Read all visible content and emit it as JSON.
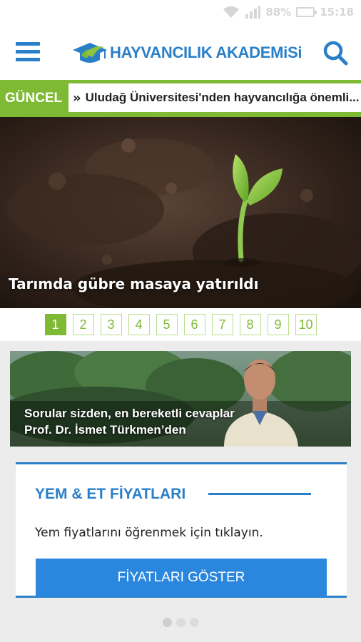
{
  "status_bar": {
    "battery": "88%",
    "time": "15:18",
    "icons": [
      "wifi-icon",
      "signal-icon",
      "battery-icon"
    ]
  },
  "header": {
    "brand": "HAYVANCILIK AKADEMiSi",
    "menu_icon": "hamburger-menu-icon",
    "search_icon": "search-icon"
  },
  "ticker": {
    "label": "GÜNCEL",
    "arrow": "»",
    "headline": "Uludağ Üniversitesi'nden hayvancılığa önemli..."
  },
  "hero": {
    "caption": "Tarımda gübre masaya yatırıldı"
  },
  "pagination": {
    "pages": [
      "1",
      "2",
      "3",
      "4",
      "5",
      "6",
      "7",
      "8",
      "9",
      "10"
    ],
    "active_index": 0
  },
  "promo": {
    "line1": "Sorular sizden, en bereketli cevaplar",
    "line2": "Prof. Dr. İsmet Türkmen’den"
  },
  "price_card": {
    "title": "YEM & ET FİYATLARI",
    "text": "Yem fiyatlarını öğrenmek için tıklayın.",
    "button_label": "FİYATLARI GÖSTER"
  },
  "carousel_dots": {
    "count": 3,
    "active_index": 0
  },
  "colors": {
    "brand_blue": "#2a7fc9",
    "button_blue": "#2a87dd",
    "accent_green": "#7fba35"
  }
}
